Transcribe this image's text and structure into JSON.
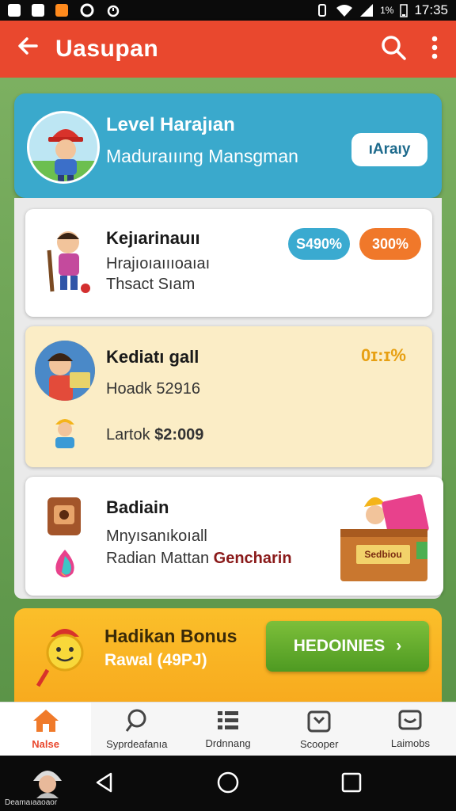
{
  "status_bar": {
    "time": "17:35",
    "battery": "1%"
  },
  "app_bar": {
    "title": "Uasupan"
  },
  "level_card": {
    "title": "Level Harajıan",
    "subtitle": "Maduraıııng Mansgman",
    "button": "ıAraıy"
  },
  "cards": [
    {
      "title": "Kejıarinauıı",
      "line1": "Hrajıoıaıııoaıaı",
      "line2": "Thsact Sıam",
      "badge1": "S490%",
      "badge2": "300%",
      "badge1_color": "#3aaad0",
      "badge2_color": "#f0782a"
    },
    {
      "title": "Kediatı gall",
      "line1": "Hoadk 52916",
      "line2_prefix": "Lartok",
      "line2_amount": "$2:009",
      "percent": "0ɪ:ɪ%"
    },
    {
      "title": "Badiain",
      "line1": "Mnyısanıkoıall",
      "line2_prefix": "Radian Mattan",
      "line2_highlight": "Gencharin",
      "box_label": "Sedbiou"
    }
  ],
  "bonus": {
    "title": "Hadikan Bonus",
    "subtitle": "Rawal (49PJ)",
    "button": "HEDOINIES",
    "button_chevron": "›"
  },
  "bottom_nav": [
    {
      "label": "Nalse",
      "icon": "home-icon",
      "active": true
    },
    {
      "label": "Syprdeafanıa",
      "icon": "search-icon",
      "active": false
    },
    {
      "label": "Drdnnang",
      "icon": "list-icon",
      "active": false
    },
    {
      "label": "Scooper",
      "icon": "shop-icon",
      "active": false
    },
    {
      "label": "Laimobs",
      "icon": "inbox-icon",
      "active": false
    }
  ],
  "system_nav": {
    "profile_label": "Deamaıaaoaor"
  },
  "colors": {
    "app_bar": "#e9482e",
    "level_card": "#3aa9cc",
    "bonus": "#f7a51b",
    "accent_green": "#5aa52a"
  }
}
